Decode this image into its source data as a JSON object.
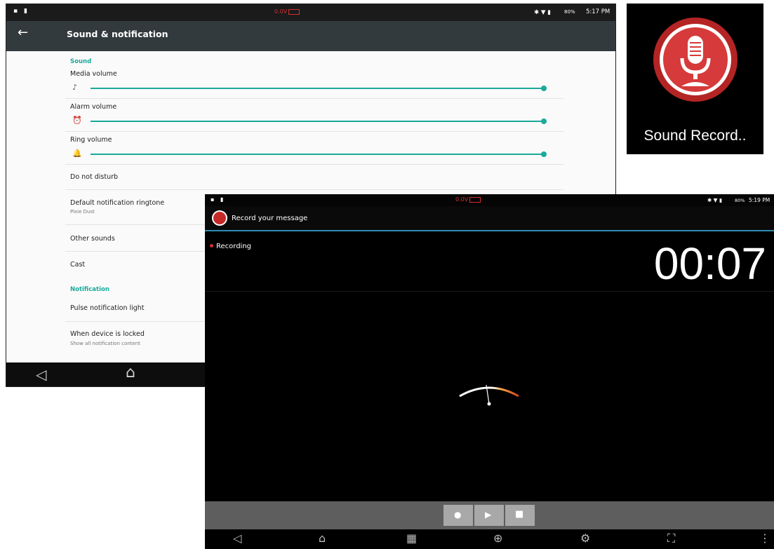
{
  "settings": {
    "status": {
      "left_icons": "▪ ▮",
      "voltage": "0.0V",
      "right_icons": "✱ ▼ ▮",
      "battery": "80%",
      "time": "5:17 PM"
    },
    "title": "Sound & notification",
    "back_icon": "←",
    "sections": {
      "sound": "Sound",
      "notification": "Notification"
    },
    "media_volume": {
      "label": "Media volume",
      "icon": "♪",
      "level": 1.0
    },
    "alarm_volume": {
      "label": "Alarm volume",
      "icon": "⏰",
      "level": 1.0
    },
    "ring_volume": {
      "label": "Ring volume",
      "icon": "🔔",
      "level": 1.0
    },
    "items": {
      "do_not_disturb": "Do not disturb",
      "default_ringtone": "Default notification ringtone",
      "default_ringtone_value": "Pixie Dust",
      "other_sounds": "Other sounds",
      "cast": "Cast",
      "pulse_light": "Pulse notification light",
      "when_locked": "When device is locked",
      "when_locked_value": "Show all notification content"
    },
    "nav": {
      "back": "◁",
      "home": "⌂"
    }
  },
  "app_icon": {
    "label": "Sound Record..",
    "icon": "microphone-icon"
  },
  "recorder": {
    "status": {
      "left_icons": "▪ ▮",
      "voltage": "0.0V",
      "right_icons": "✱ ▼ ▮",
      "battery": "80%",
      "time": "5:19 PM"
    },
    "title": "Record your message",
    "state": "Recording",
    "timer": "00:07",
    "controls": {
      "record": "●",
      "play": "▶",
      "stop": "■"
    },
    "nav": {
      "back": "◁",
      "home": "⌂",
      "recents": "▦",
      "browser": "⊕",
      "settings": "⚙",
      "screenshot": "⛶",
      "menu": "⋮"
    },
    "colors": {
      "accent": "#2f8db3",
      "rec": "#d32f2f"
    }
  }
}
